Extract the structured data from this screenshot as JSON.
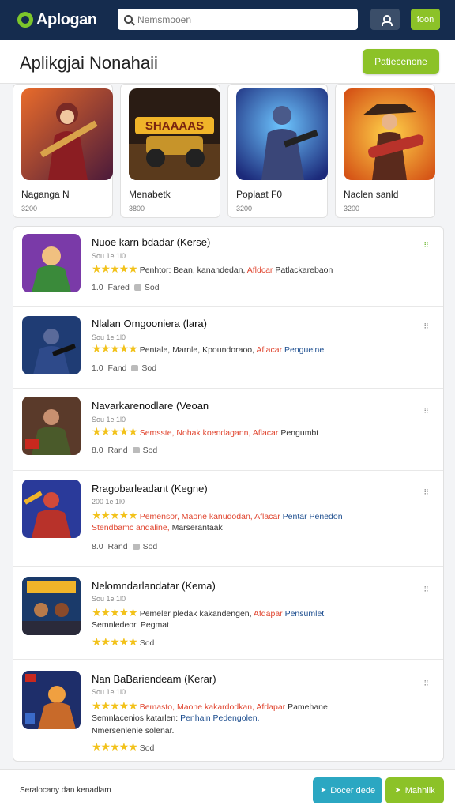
{
  "topbar": {
    "logo_text": "Aplogan",
    "search_placeholder": "Nemsmooen",
    "green_button": "foon"
  },
  "header": {
    "title": "Aplikgjai Nonahaii",
    "button": "Patiecenone"
  },
  "featured": [
    {
      "name": "Naganga N",
      "sub": "3200",
      "thumb_text": "",
      "icon": "game-thumbnail-warrior"
    },
    {
      "name": "Menabetk",
      "sub": "3800",
      "thumb_text": "SHAAAAS",
      "icon": "game-thumbnail-vehicle"
    },
    {
      "name": "Poplaat F0",
      "sub": "3200",
      "thumb_text": "",
      "icon": "game-thumbnail-soldier"
    },
    {
      "name": "Naclen sanld",
      "sub": "3200",
      "thumb_text": "",
      "icon": "game-thumbnail-gunslinger"
    }
  ],
  "apps": [
    {
      "title": "Nuoe karn bdadar (Kerse)",
      "meta": "Sou 1e 1l0",
      "stars": "★★★★★",
      "desc_a": "Penhtor: Bean, kanandedan,",
      "desc_accent": "Afldcar",
      "desc_b": "Patlackarebaon",
      "desc2": "",
      "foot_a": "1.0",
      "foot_b": "Fared",
      "foot_c": "Sod",
      "more": "⠿"
    },
    {
      "title": "Nlalan Omgooniera (lara)",
      "meta": "Sou 1e 1l0",
      "stars": "★★★★★",
      "desc_a": "Pentale, Marnle, Kpoundoraoo,",
      "desc_accent": "Aflacar",
      "desc_b": "Penguelne",
      "desc2": "",
      "foot_a": "1.0",
      "foot_b": "Fand",
      "foot_c": "Sod",
      "more": "⠿"
    },
    {
      "title": "Navarkarenodlare (Veoan",
      "meta": "Sou 1e 1l0",
      "stars": "★★★★★",
      "desc_a": "Semsste, Nohak koendagann,",
      "desc_accent": "Aflacar",
      "desc_b": "Pengumbt",
      "desc2": "",
      "foot_a": "8.0",
      "foot_b": "Rand",
      "foot_c": "Sod",
      "more": "⠿"
    },
    {
      "title": "Rragobarleadant (Kegne)",
      "meta": "200 1e 1l0",
      "stars": "★★★★★",
      "desc_a": "Pemensor, Maone kanudodan,",
      "desc_accent": "Aflacar",
      "desc_b": "Pentar Penedon",
      "desc2_accent": "Stendbamc andaline,",
      "desc2": "Marserantaak",
      "foot_a": "8.0",
      "foot_b": "Rand",
      "foot_c": "Sod",
      "more": "⠿"
    },
    {
      "title": "Nelomndarlandatar (Kema)",
      "meta": "Sou 1e 1l0",
      "stars": "★★★★★",
      "desc_a": "Pemeler pledak kakandengen,",
      "desc_accent": "Afdapar",
      "desc_b": "Pensumlet",
      "desc2": "Semnledeor, Pegmat",
      "foot_a": "",
      "foot_b": "",
      "foot_c": "Sod",
      "more": "⠿"
    },
    {
      "title": "Nan BaBariendeam (Kerar)",
      "meta": "Sou 1e 1l0",
      "stars": "★★★★★",
      "desc_a": "Bemasto, Maone kakardodkan,",
      "desc_accent": "Afdapar",
      "desc_b": "Pamehane",
      "desc2": "Semnlacenios katarlen:",
      "desc2_blue": "Penhain Pedengolen.",
      "desc3": "Nmersenlenie solenar.",
      "foot_a": "",
      "foot_b": "",
      "foot_c": "Sod",
      "more": "⠿"
    }
  ],
  "bottombar": {
    "text": "Seralocany dan kenadlam",
    "blue_button": "Docer dede",
    "green_button": "Mahhlik"
  },
  "colors": {
    "topbar": "#152c4e",
    "accent_green": "#8cc228",
    "accent_blue": "#2ba7c2",
    "star": "#f2c21b",
    "link_red": "#e0452f"
  }
}
